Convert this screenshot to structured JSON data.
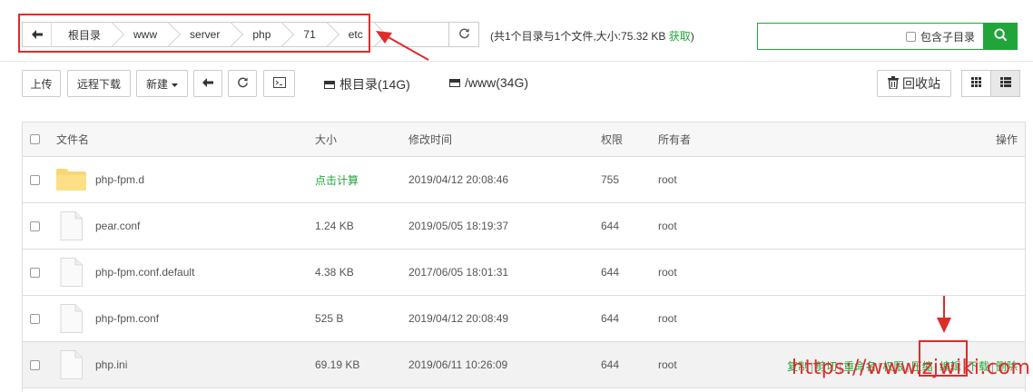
{
  "path": {
    "crumbs": [
      "根目录",
      "www",
      "server",
      "php",
      "71",
      "etc"
    ],
    "stats_prefix": "(共1个目录与1个文件,大小:",
    "stats_size": "75.32 KB",
    "stats_link": "获取",
    "stats_suffix": ")",
    "include_subdir_label": "包含子目录",
    "search_placeholder": ""
  },
  "toolbar": {
    "upload": "上传",
    "remote_download": "远程下载",
    "new": "新建",
    "disk_root": "根目录(14G)",
    "disk_www": "/www(34G)",
    "recycle_bin": "回收站"
  },
  "table": {
    "headers": {
      "name": "文件名",
      "size": "大小",
      "mtime": "修改时间",
      "perm": "权限",
      "owner": "所有者",
      "ops": "操作"
    },
    "rows": [
      {
        "name": "php-fpm.d",
        "type": "folder",
        "size": "点击计算",
        "mtime": "2019/04/12 20:08:46",
        "perm": "755",
        "owner": "root"
      },
      {
        "name": "pear.conf",
        "type": "file",
        "size": "1.24 KB",
        "mtime": "2019/05/05 18:19:37",
        "perm": "644",
        "owner": "root"
      },
      {
        "name": "php-fpm.conf.default",
        "type": "file",
        "size": "4.38 KB",
        "mtime": "2017/06/05 18:01:31",
        "perm": "644",
        "owner": "root"
      },
      {
        "name": "php-fpm.conf",
        "type": "file",
        "size": "525 B",
        "mtime": "2019/04/12 20:08:49",
        "perm": "644",
        "owner": "root"
      },
      {
        "name": "php.ini",
        "type": "file",
        "size": "69.19 KB",
        "mtime": "2019/06/11 10:26:09",
        "perm": "644",
        "owner": "root"
      }
    ],
    "row_actions": [
      "复制",
      "剪切",
      "重命名",
      "权限",
      "压缩",
      "编辑",
      "下载",
      "删除"
    ]
  },
  "watermark": "https://www.zjwiki.com",
  "colors": {
    "accent": "#20a53a",
    "annotation": "#e02b2b"
  }
}
